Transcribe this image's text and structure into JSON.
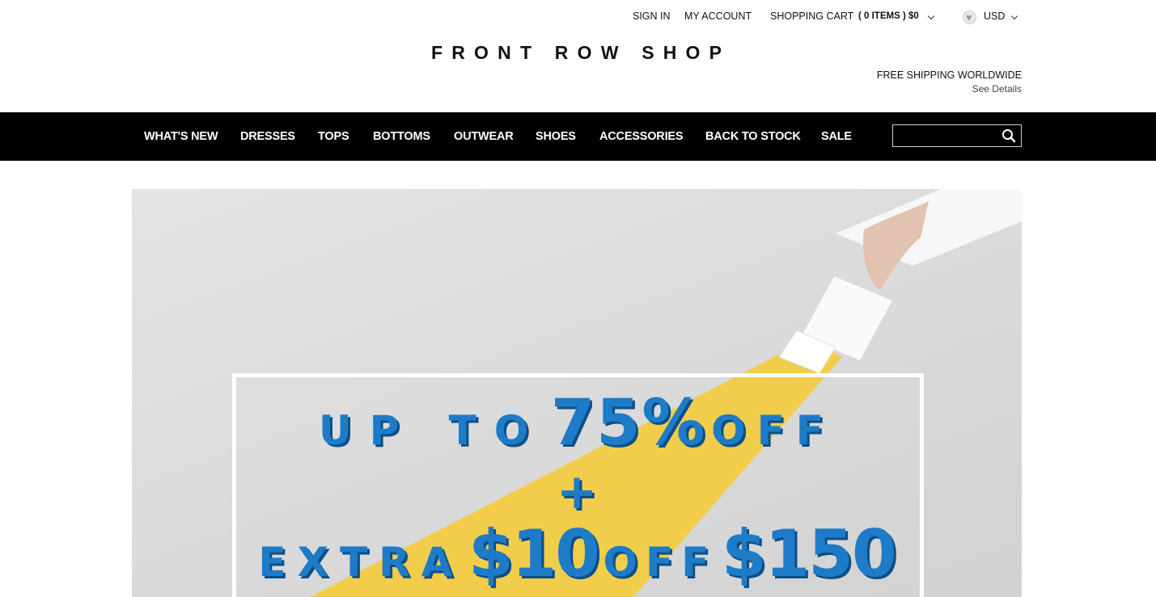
{
  "header": {
    "sign_in": "SIGN IN",
    "my_account": "MY ACCOUNT",
    "shopping_cart": "SHOPPING CART",
    "cart_summary": "( 0 ITEMS ) $0",
    "currency": "USD",
    "logo": "FRONT ROW SHOP",
    "shipping_title": "FREE SHIPPING WORLDWIDE",
    "shipping_link": "See Details"
  },
  "nav": {
    "items": [
      "WHAT'S NEW",
      "DRESSES",
      "TOPS",
      "BOTTOMS",
      "OUTWEAR",
      "SHOES",
      "ACCESSORIES",
      "BACK TO STOCK",
      "SALE"
    ],
    "search_placeholder": ""
  },
  "hero": {
    "line1_a": "UP TO",
    "line1_b": "75%",
    "line1_c": "OFF",
    "line2": "+",
    "line3_a": "EXTRA",
    "line3_b": "$10",
    "line3_c": "OFF",
    "line3_d": "$150"
  },
  "colors": {
    "nav_bg": "#000000",
    "promo_blue": "#1e7bc7",
    "promo_shadow": "#0c4f86",
    "beam_yellow": "#f2cd4c"
  },
  "icons": [
    "heart-icon",
    "chevron-down-icon",
    "search-icon"
  ]
}
